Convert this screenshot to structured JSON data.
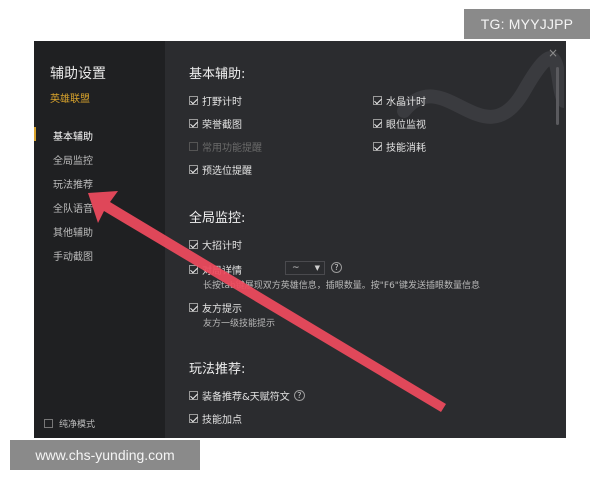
{
  "watermarks": {
    "top": "TG: MYYJJPP",
    "bottom": "www.chs-yunding.com"
  },
  "window": {
    "close_symbol": "×",
    "sidebar": {
      "title": "辅助设置",
      "subtitle": "英雄联盟",
      "items": [
        {
          "label": "基本辅助",
          "active": true
        },
        {
          "label": "全局监控",
          "active": false
        },
        {
          "label": "玩法推荐",
          "active": false
        },
        {
          "label": "全队语音",
          "active": false
        },
        {
          "label": "其他辅助",
          "active": false
        },
        {
          "label": "手动截图",
          "active": false
        }
      ],
      "footer_label": "纯净模式"
    },
    "sections": {
      "basic": {
        "title": "基本辅助:",
        "options": [
          {
            "label": "打野计时",
            "checked": true
          },
          {
            "label": "水晶计时",
            "checked": true
          },
          {
            "label": "荣誉截图",
            "checked": true
          },
          {
            "label": "眼位监视",
            "checked": true
          },
          {
            "label": "常用功能提醒",
            "checked": false,
            "disabled": true
          },
          {
            "label": "技能消耗",
            "checked": true
          },
          {
            "label": "预选位提醒",
            "checked": true
          }
        ]
      },
      "global": {
        "title": "全局监控:",
        "options": [
          {
            "label": "大招计时",
            "checked": true
          },
          {
            "label": "对局详情",
            "checked": true
          },
          {
            "label": "友方提示",
            "checked": true
          }
        ],
        "select_value": "~",
        "desc1": "长按tab键展现双方英雄信息，插眼数量。按\"F6\"键发送插眼数量信息",
        "desc2": "友方一级技能提示"
      },
      "play": {
        "title": "玩法推荐:",
        "options": [
          {
            "label": "装备推荐&天赋符文",
            "checked": true
          },
          {
            "label": "技能加点",
            "checked": true
          }
        ]
      }
    }
  },
  "colors": {
    "sidebar_bg": "#1f2022",
    "panel_bg": "#2b2c2f",
    "accent": "#d6a12c",
    "arrow": "#ee4a5e"
  }
}
